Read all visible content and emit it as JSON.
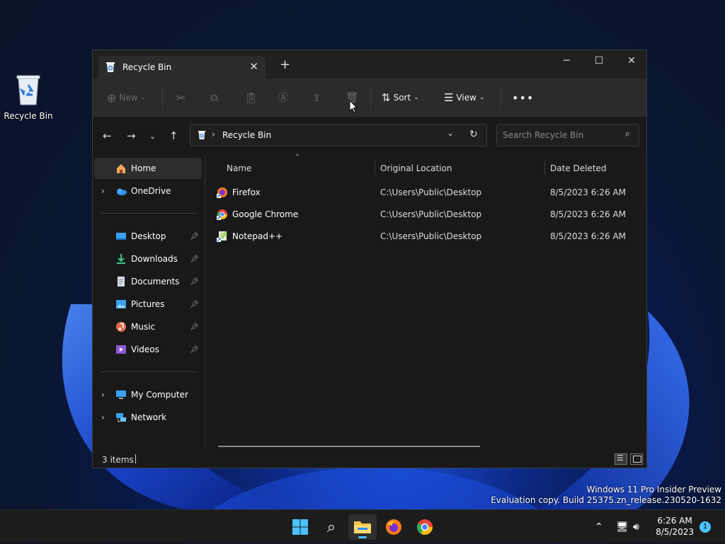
{
  "desktop": {
    "recycle_bin_label": "Recycle Bin"
  },
  "watermark": {
    "line1": "Windows 11 Pro Insider Preview",
    "line2": "Evaluation copy. Build 25375.zn_release.230520-1632"
  },
  "window": {
    "tab_title": "Recycle Bin",
    "command_bar": {
      "new_label": "New",
      "sort_label": "Sort",
      "view_label": "View"
    },
    "address": {
      "crumb": "Recycle Bin",
      "search_placeholder": "Search Recycle Bin"
    },
    "sidebar": {
      "home": "Home",
      "onedrive": "OneDrive",
      "quick_access": [
        {
          "label": "Desktop",
          "icon": "desktop-icon"
        },
        {
          "label": "Downloads",
          "icon": "downloads-icon"
        },
        {
          "label": "Documents",
          "icon": "documents-icon"
        },
        {
          "label": "Pictures",
          "icon": "pictures-icon"
        },
        {
          "label": "Music",
          "icon": "music-icon"
        },
        {
          "label": "Videos",
          "icon": "videos-icon"
        }
      ],
      "my_computer": "My Computer",
      "network": "Network"
    },
    "columns": {
      "name": "Name",
      "original_location": "Original Location",
      "date_deleted": "Date Deleted"
    },
    "files": [
      {
        "name": "Firefox",
        "location": "C:\\Users\\Public\\Desktop",
        "date": "8/5/2023 6:26 AM",
        "icon": "firefox-shortcut-icon"
      },
      {
        "name": "Google Chrome",
        "location": "C:\\Users\\Public\\Desktop",
        "date": "8/5/2023 6:26 AM",
        "icon": "chrome-shortcut-icon"
      },
      {
        "name": "Notepad++",
        "location": "C:\\Users\\Public\\Desktop",
        "date": "8/5/2023 6:26 AM",
        "icon": "notepadpp-shortcut-icon"
      }
    ],
    "status": {
      "items_count": "3 items"
    }
  },
  "taskbar": {
    "clock_time": "6:26 AM",
    "clock_date": "8/5/2023",
    "notification_count": "1"
  },
  "colors": {
    "accent": "#4cc2ff",
    "window_bg": "#191919",
    "command_bar_bg": "#2b2b2b"
  }
}
